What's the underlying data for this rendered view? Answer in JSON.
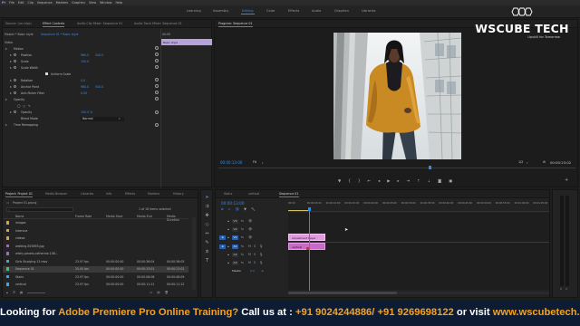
{
  "menu": [
    "Pr",
    "File",
    "Edit",
    "Clip",
    "Sequence",
    "Markers",
    "Graphics",
    "View",
    "Window",
    "Help"
  ],
  "workspaces": [
    "Learning",
    "Assembly",
    "Editing",
    "Color",
    "Effects",
    "Audio",
    "Graphics",
    "Libraries"
  ],
  "active_workspace": "Editing",
  "logo": {
    "brand": "WSCUBE TECH",
    "tagline": "Upskill for Tomorrow"
  },
  "effect_controls": {
    "tabs": [
      "Source: (no clips)",
      "Effect Controls",
      "Audio Clip Mixer: Sequence 01",
      "Audio Track Mixer: Sequence 01"
    ],
    "master": "Master * Basic style",
    "clip": "Sequence 01 * Basic style",
    "timecode": "00:00",
    "clip_label": "Basic style",
    "section": "Video",
    "rows": [
      {
        "label": "Motion",
        "kind": "group"
      },
      {
        "label": "Position",
        "v1": "960.0",
        "v2": "540.0"
      },
      {
        "label": "Scale",
        "v1": "100.0"
      },
      {
        "label": "Scale Width",
        "v1": ""
      },
      {
        "label": "Uniform Scale",
        "kind": "check"
      },
      {
        "label": "Rotation",
        "v1": "0.0"
      },
      {
        "label": "Anchor Point",
        "v1": "960.0",
        "v2": "540.0"
      },
      {
        "label": "Anti-flicker Filter",
        "v1": "0.00"
      },
      {
        "label": "Opacity",
        "kind": "group"
      },
      {
        "label": "",
        "kind": "masks"
      },
      {
        "label": "Opacity",
        "v1": "100.0 %"
      },
      {
        "label": "Blend Mode",
        "v1": "Normal",
        "kind": "select"
      },
      {
        "label": "Time Remapping",
        "kind": "group"
      }
    ]
  },
  "program": {
    "title": "Program: Sequence 01",
    "timecode": "00:00:13:00",
    "fit": "Fit",
    "quality": "1/2",
    "duration": "00:00:23:02"
  },
  "project": {
    "tabs": [
      "Project: Project 01",
      "Media Browser",
      "Libraries",
      "Info",
      "Effects",
      "Markers",
      "History"
    ],
    "file": "Project 01.prproj",
    "items_selected": "1 of 16 items selected",
    "columns": [
      "Name",
      "Frame Rate",
      "Media Start",
      "Media End",
      "Media Duration"
    ],
    "rows": [
      {
        "color": "#d9a441",
        "name": "images",
        "fr": "",
        "ms": "",
        "me": "",
        "md": ""
      },
      {
        "color": "#d9a441",
        "name": "Intervue",
        "fr": "",
        "ms": "",
        "me": "",
        "md": ""
      },
      {
        "color": "#d9a441",
        "name": "videos",
        "fr": "",
        "ms": "",
        "me": "",
        "md": ""
      },
      {
        "color": "#a569bd",
        "name": "walking-503893.jpg",
        "fr": "",
        "ms": "",
        "me": "",
        "md": ""
      },
      {
        "color": "#a569bd",
        "name": "wishy-pexels-catherine-108...",
        "fr": "",
        "ms": "",
        "me": "",
        "md": ""
      },
      {
        "color": "#4aa3df",
        "name": "Girls Studying 13.mov",
        "fr": "23.97 fps",
        "ms": "00:00:00:00",
        "me": "00:00:36:04",
        "md": "00:00:36:05"
      },
      {
        "color": "#2ecc71",
        "name": "Sequence 01",
        "fr": "25.00 fps",
        "ms": "00:00:00:00",
        "me": "00:00:23:01",
        "md": "00:00:23:02"
      },
      {
        "color": "#4aa3df",
        "name": "Stairs",
        "fr": "23.97 fps",
        "ms": "00:00:00:00",
        "me": "00:00:08:08",
        "md": "00:00:08:09"
      },
      {
        "color": "#4aa3df",
        "name": "vertical",
        "fr": "23.97 fps",
        "ms": "00:00:00:00",
        "me": "00:00:11:11",
        "md": "00:00:11:12"
      }
    ]
  },
  "timeline": {
    "tabs": [
      "Stairs",
      "vertical",
      "Sequence 01"
    ],
    "timecode": "00:00:13:00",
    "ruler": [
      "00:00",
      "00:00:05:00",
      "00:00:10:00",
      "00:00:15:00",
      "00:00:20:00",
      "00:00:25:00",
      "00:00:30:00",
      "00:00:35:00",
      "00:00:40:00",
      "00:00:45:00",
      "00:00:50:00",
      "00:00:55:00",
      "00:01:00:00",
      "00:01:05:00"
    ],
    "video_tracks": [
      "V3",
      "V2",
      "V1"
    ],
    "audio_tracks": [
      "A1",
      "A2",
      "A3"
    ],
    "master_label": "Master",
    "master_value": "0.0",
    "clip_adjustment": "Adjustment Layer",
    "clip_video": "vertical",
    "clip_audio": ""
  },
  "banner": {
    "part1": "Looking for ",
    "part2": "Adobe Premiere Pro Online Training?",
    "part3": " Call us at : ",
    "part4": "+91 9024244886/ +91 9269698122",
    "part5": " or visit ",
    "part6": "www.wscubetech.com"
  },
  "colors": {
    "accent": "#2d8ceb",
    "adjustment_clip": "#e39be0",
    "video_clip": "#c86bc8",
    "banner_bg": "#0d1c33",
    "banner_highlight": "#f7a21b"
  }
}
